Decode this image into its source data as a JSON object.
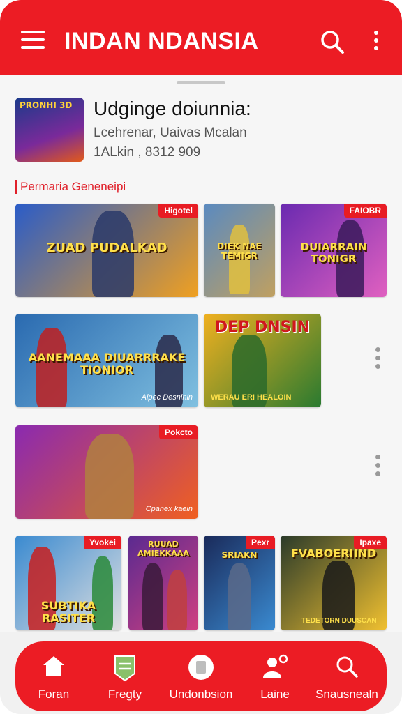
{
  "app_bar": {
    "title": "INDAN NDANSIA",
    "menu_icon": "hamburger-menu-icon",
    "search_icon": "search-icon",
    "more_icon": "vertical-ellipsis-icon",
    "color": "#ec1c24"
  },
  "profile": {
    "thumb_label": "PRONHI  3D",
    "title": "Udginge doiunnia:",
    "subtitle": "Lcehrenar, Uaivas  Mcalan",
    "meta": "1ALkin ,  8312  909"
  },
  "section": {
    "label": "Permaria Geneneipi"
  },
  "cards": [
    {
      "badge": "Higotel",
      "headline": "ZUAD PUDALKAD",
      "caption": "",
      "bg": "#2a5cc8",
      "bg2": "#f0a020"
    },
    {
      "badge": "",
      "headline": "DIEK NAE TEMIGR",
      "caption": "",
      "bg": "#5a8ac0",
      "bg2": "#c0a060"
    },
    {
      "badge": "FAIOBR",
      "headline": "DUIARRAIN TONIGR",
      "caption": "",
      "bg": "#6a2ab0",
      "bg2": "#e060c0"
    },
    {
      "badge": "",
      "headline": "AANEMAAA DIUARRRAKE TIONIOR",
      "caption": "Alpec Desninin",
      "bg": "#2a6ab0",
      "bg2": "#80c0e0"
    },
    {
      "badge": "",
      "headline": "DEP DNSIN",
      "caption": "WERAU ERI HEALOIN",
      "bg": "#f0b020",
      "bg2": "#2a7a30"
    },
    {
      "badge": "Pokcto",
      "headline": "",
      "caption": "Cpanex kaein",
      "bg": "#8a2ab0",
      "bg2": "#f06020"
    },
    {
      "badge": "Yvokei",
      "headline": "SUBTIKA RASITER",
      "caption": "",
      "bg": "#3a8ad0",
      "bg2": "#e0e0e0"
    },
    {
      "badge": "",
      "headline": "RUUAD AMIEKKAAA",
      "caption": "",
      "bg": "#5a2a90",
      "bg2": "#d04080"
    },
    {
      "badge": "Pexr",
      "headline": "SRIAKN",
      "caption": "",
      "bg": "#1a2a5a",
      "bg2": "#3a8ad0"
    },
    {
      "badge": "Ipaxe",
      "headline": "FVABOERIIND",
      "caption": "TEDETORN DUUSCAN",
      "bg": "#2a3a2a",
      "bg2": "#f0c030"
    }
  ],
  "bottom_nav": [
    {
      "label": "Foran",
      "icon": "home-icon"
    },
    {
      "label": "Fregty",
      "icon": "tag-icon"
    },
    {
      "label": "Undonbsion",
      "icon": "circle-badge-icon"
    },
    {
      "label": "Laine",
      "icon": "person-gear-icon"
    },
    {
      "label": "Snausnealn",
      "icon": "search-icon"
    }
  ]
}
